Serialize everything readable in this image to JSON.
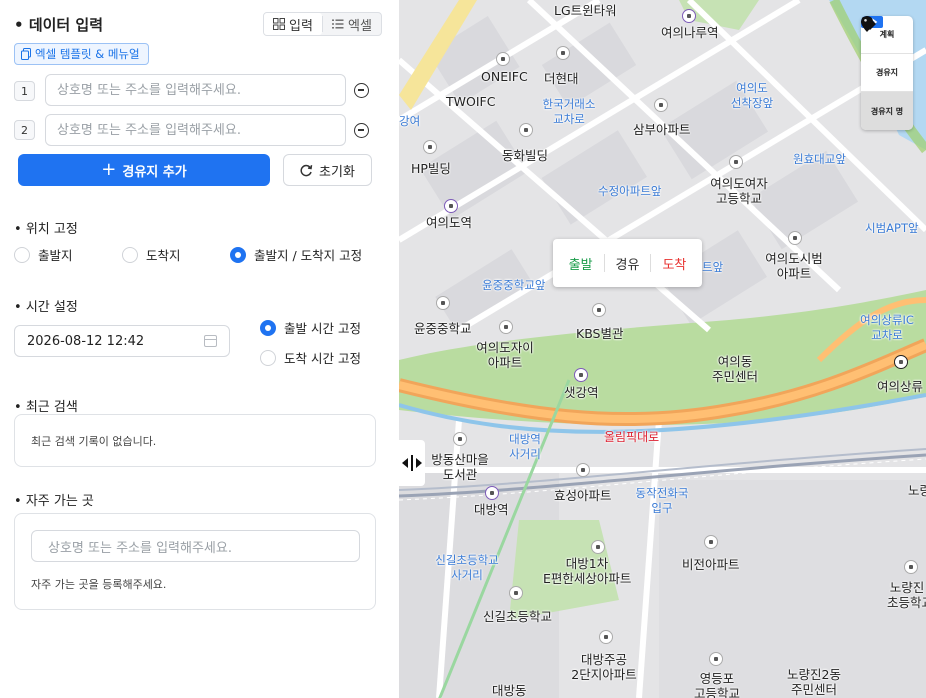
{
  "panel": {
    "data_input_title": "데이터 입력",
    "mode_input": "입력",
    "mode_excel": "엑셀",
    "template_link": "엑셀 템플릿 & 메뉴얼",
    "stops": [
      {
        "index": "1",
        "placeholder": "상호명 또는 주소를 입력해주세요."
      },
      {
        "index": "2",
        "placeholder": "상호명 또는 주소를 입력해주세요."
      }
    ],
    "add_waypoint": "경유지 추가",
    "reset": "초기화",
    "location_fix": {
      "title": "위치 고정",
      "options": [
        "출발지",
        "도착지",
        "출발지 / 도착지 고정"
      ],
      "selected": "출발지 / 도착지 고정"
    },
    "time_setting": {
      "title": "시간 설정",
      "datetime": "2026-08-12 12:42",
      "options": [
        "출발 시간 고정",
        "도착 시간 고정"
      ],
      "selected": "출발 시간 고정"
    },
    "recent": {
      "title": "최근 검색",
      "empty": "최근 검색 기록이 없습니다."
    },
    "favorites": {
      "title": "자주 가는 곳",
      "placeholder": "상호명 또는 주소를 입력해주세요.",
      "empty": "자주 가는 곳을 등록해주세요."
    }
  },
  "map": {
    "popup": {
      "start": "출발",
      "via": "경유",
      "end": "도착"
    },
    "controls": {
      "plan": "계획",
      "waypoint": "경유지",
      "waypoint_name": "경유지 명"
    },
    "labels": {
      "lg_twin": "LG트윈타워",
      "yeouinaru": "여의나루역",
      "onefc": "ONEIFC",
      "thehyundai": "더현대",
      "twoifc": "TWOIFC",
      "krx": "한국거래소 교차로",
      "sambu": "삼부아파트",
      "yeouido_plaza": "여의도 선착장앞",
      "hp": "HP빌딩",
      "donghwa": "동화빌딩",
      "wonhyo": "원효대교앞",
      "sujeong": "수정아파트앞",
      "girls_high": "여의도여자 고등학교",
      "yeouido_stn": "여의도역",
      "sibeom_apt_ap": "시범APT앞",
      "yunjung_mid_ap": "윤중중학교앞",
      "teuap": "트앞",
      "sibeom": "여의도시범 아파트",
      "yunjung_mid": "윤중중학교",
      "kbs": "KBS별관",
      "yeouisang_ic": "여의상류IC 교차로",
      "jai": "여의도자이 아파트",
      "community": "여의동 주민센터",
      "saetgang": "샛강역",
      "yeouisang": "여의상류",
      "olympic": "올림픽대로",
      "daebang_cross": "대방역 사거리",
      "library": "방동산마을 도서관",
      "hyoseong": "효성아파트",
      "dongjak": "동작전화국 입구",
      "daebang": "대방역",
      "noryang_cut": "노량",
      "singil_cross": "신길초등학교 사거리",
      "e_apt": "대방1차 E편한세상아파트",
      "bijeon": "비전아파트",
      "noryangjin_elem": "노량진 초등학교",
      "singil_elem": "신길초등학교",
      "daebang_apt": "대방주공 2단지아파트",
      "daebangdong": "대방동",
      "yeongdeungpo_high": "영등포 고등학교",
      "noryangjin2": "노량진2동 주민센터",
      "kangyeo": "강여"
    }
  }
}
